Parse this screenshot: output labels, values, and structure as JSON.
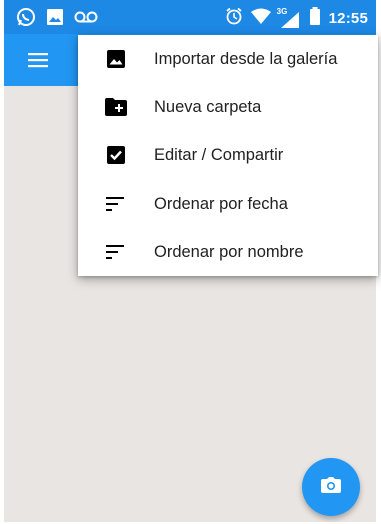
{
  "status_bar": {
    "time": "12:55",
    "network_label": "3G",
    "left_icons": [
      "whatsapp-icon",
      "image-notification-icon",
      "voicemail-icon"
    ],
    "right_icons": [
      "alarm-icon",
      "wifi-icon",
      "signal-icon",
      "battery-icon"
    ]
  },
  "app_bar": {
    "menu_icon": "hamburger-menu-icon",
    "color": "#2196f3"
  },
  "overflow_menu": {
    "items": [
      {
        "label": "Importar desde la galería",
        "icon": "image-icon"
      },
      {
        "label": "Nueva carpeta",
        "icon": "new-folder-icon"
      },
      {
        "label": "Editar / Compartir",
        "icon": "checkbox-icon"
      },
      {
        "label": "Ordenar por fecha",
        "icon": "sort-icon"
      },
      {
        "label": "Ordenar por nombre",
        "icon": "sort-icon"
      }
    ]
  },
  "fab": {
    "icon": "camera-icon",
    "color": "#2196f3"
  },
  "colors": {
    "status_bar": "#1e88e5",
    "background": "#e9e5e2",
    "menu_text": "#212121"
  }
}
